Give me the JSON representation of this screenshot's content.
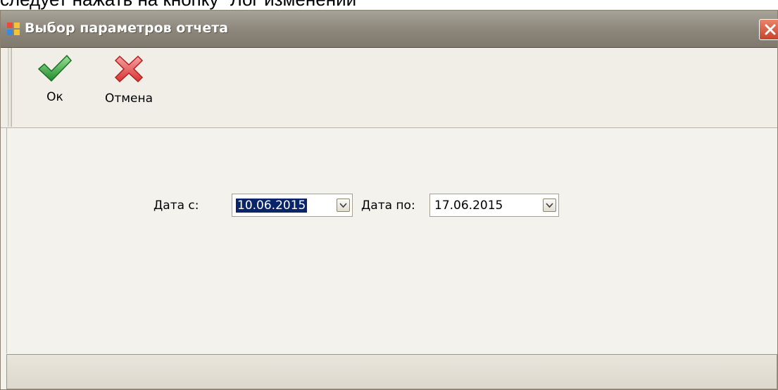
{
  "document": {
    "caption_fragment": "следует нажать на кнопку \"Лог изменений\""
  },
  "window": {
    "title": "Выбор параметров отчета",
    "icons": {
      "app": "app-window-icon",
      "close": "close-icon"
    }
  },
  "toolbar": {
    "ok_label": "Ок",
    "cancel_label": "Отмена",
    "icons": {
      "ok": "green-check-icon",
      "cancel": "red-x-icon"
    }
  },
  "form": {
    "date_from_label": "Дата с:",
    "date_from_value": "10.06.2015",
    "date_to_label": "Дата по:",
    "date_to_value": "17.06.2015"
  },
  "colors": {
    "selection": "#0a246a",
    "titlebar": "#8b857a",
    "ok_green": "#3aa63a",
    "cancel_red": "#e04a4a"
  }
}
